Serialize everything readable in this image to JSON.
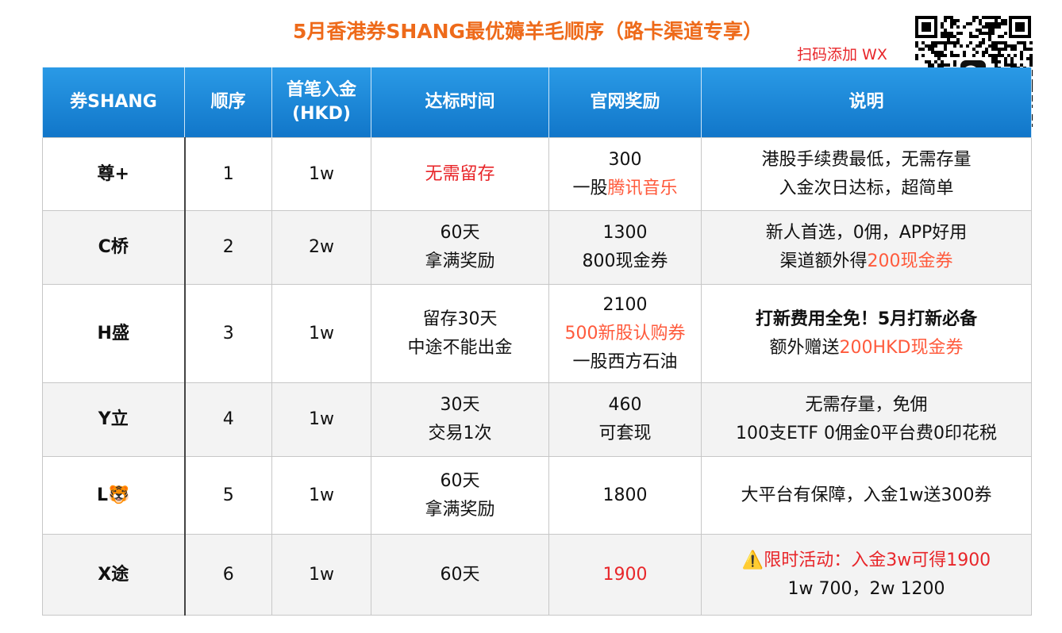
{
  "title": "5月香港券SHANG最优薅羊毛顺序（路卡渠道专享）",
  "scan_label": "扫码添加 WX",
  "colors": {
    "accent": "#ee6a1a",
    "header_bg": "#1e88d6",
    "highlight_red": "#e8262a"
  },
  "headers": {
    "broker": "券SHANG",
    "order": "顺序",
    "deposit_line1": "首笔入金",
    "deposit_line2": "(HKD)",
    "time": "达标时间",
    "reward": "官网奖励",
    "notes": "说明"
  },
  "rows": [
    {
      "broker": "尊+",
      "order": "1",
      "deposit": "1w",
      "time": [
        "无需留存"
      ],
      "reward": [
        "300",
        "一股",
        "腾讯音乐"
      ],
      "notes_l1": "港股手续费最低，无需存量",
      "notes_l2": "入金次日达标，超简单"
    },
    {
      "broker": "C桥",
      "order": "2",
      "deposit": "2w",
      "time": [
        "60天",
        "拿满奖励"
      ],
      "reward": [
        "1300",
        "800现金券"
      ],
      "notes_l1": "新人首选，0佣，APP好用",
      "notes_l2a": "渠道额外得",
      "notes_l2b": "200现金券"
    },
    {
      "broker": "H盛",
      "order": "3",
      "deposit": "1w",
      "time": [
        "留存30天",
        "中途不能出金"
      ],
      "reward": [
        "2100",
        "500新股认购券",
        "一股西方石油"
      ],
      "notes_l1": "打新费用全免！5月打新必备",
      "notes_l2a": "额外赠送",
      "notes_l2b": "200HKD现金券"
    },
    {
      "broker": "Y立",
      "order": "4",
      "deposit": "1w",
      "time": [
        "30天",
        "交易1次"
      ],
      "reward": [
        "460",
        "可套现"
      ],
      "notes_l1": "无需存量，免佣",
      "notes_l2": "100支ETF 0佣金0平台费0印花税"
    },
    {
      "broker": "L🐯",
      "order": "5",
      "deposit": "1w",
      "time": [
        "60天",
        "拿满奖励"
      ],
      "reward": [
        "1800"
      ],
      "notes_l1": "大平台有保障，入金1w送300券"
    },
    {
      "broker": "X途",
      "order": "6",
      "deposit": "1w",
      "time": [
        "60天"
      ],
      "reward": [
        "1900"
      ],
      "notes_icon": "⚠️",
      "notes_l1": "限时活动：入金3w可得1900",
      "notes_l2": "1w 700，2w 1200"
    }
  ]
}
